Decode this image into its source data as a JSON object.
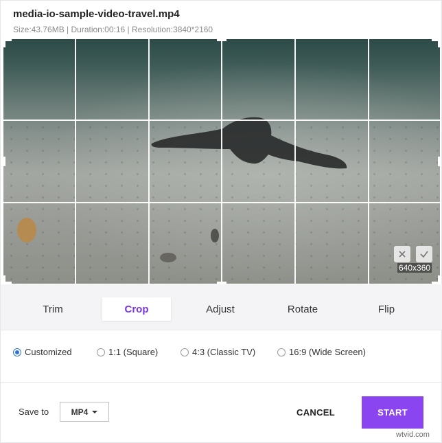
{
  "file": {
    "title": "media-io-sample-video-travel.mp4",
    "meta": "Size:43.76MB | Duration:00:16 | Resolution:3840*2160"
  },
  "crop": {
    "size_label": "640x360",
    "cancel_icon": "close-icon",
    "confirm_icon": "check-icon"
  },
  "tabs": [
    {
      "label": "Trim",
      "active": false
    },
    {
      "label": "Crop",
      "active": true
    },
    {
      "label": "Adjust",
      "active": false
    },
    {
      "label": "Rotate",
      "active": false
    },
    {
      "label": "Flip",
      "active": false
    }
  ],
  "ratios": [
    {
      "label": "Customized",
      "checked": true
    },
    {
      "label": "1:1 (Square)",
      "checked": false
    },
    {
      "label": "4:3 (Classic TV)",
      "checked": false
    },
    {
      "label": "16:9 (Wide Screen)",
      "checked": false
    }
  ],
  "footer": {
    "save_to_label": "Save to",
    "format_value": "MP4",
    "cancel_label": "CANCEL",
    "start_label": "START"
  },
  "watermark": "wtvid.com",
  "colors": {
    "accent": "#8b45f0",
    "tab_active_text": "#7a36e5",
    "radio_checked": "#2f73d9"
  }
}
